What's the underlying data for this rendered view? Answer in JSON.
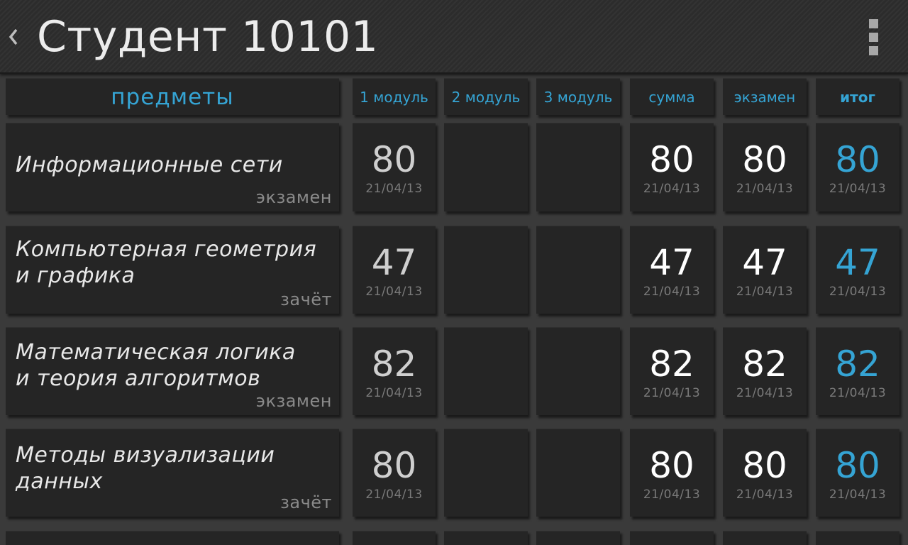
{
  "app": {
    "title": "Студент 10101"
  },
  "header": {
    "subjects": "предметы",
    "module1": "1 модуль",
    "module2": "2 модуль",
    "module3": "3 модуль",
    "sum": "сумма",
    "exam": "экзамен",
    "total": "итог"
  },
  "accent_color": "#35a4d4",
  "rows": [
    {
      "name_line1": "Информационные сети",
      "name_line2": "",
      "type": "экзамен",
      "module1": "80",
      "module1_date": "21/04/13",
      "module2": "",
      "module3": "",
      "sum": "80",
      "sum_date": "21/04/13",
      "exam": "80",
      "exam_date": "21/04/13",
      "total": "80",
      "total_date": "21/04/13"
    },
    {
      "name_line1": "Компьютерная геометрия",
      "name_line2": "и графика",
      "type": "зачёт",
      "module1": "47",
      "module1_date": "21/04/13",
      "module2": "",
      "module3": "",
      "sum": "47",
      "sum_date": "21/04/13",
      "exam": "47",
      "exam_date": "21/04/13",
      "total": "47",
      "total_date": "21/04/13"
    },
    {
      "name_line1": "Математическая логика",
      "name_line2": "и теория алгоритмов",
      "type": "экзамен",
      "module1": "82",
      "module1_date": "21/04/13",
      "module2": "",
      "module3": "",
      "sum": "82",
      "sum_date": "21/04/13",
      "exam": "82",
      "exam_date": "21/04/13",
      "total": "82",
      "total_date": "21/04/13"
    },
    {
      "name_line1": "Методы визуализации",
      "name_line2": "данных",
      "type": "зачёт",
      "module1": "80",
      "module1_date": "21/04/13",
      "module2": "",
      "module3": "",
      "sum": "80",
      "sum_date": "21/04/13",
      "exam": "80",
      "exam_date": "21/04/13",
      "total": "80",
      "total_date": "21/04/13"
    }
  ],
  "icons": {
    "back": "chevron-left-icon",
    "overflow": "overflow-menu-icon"
  }
}
